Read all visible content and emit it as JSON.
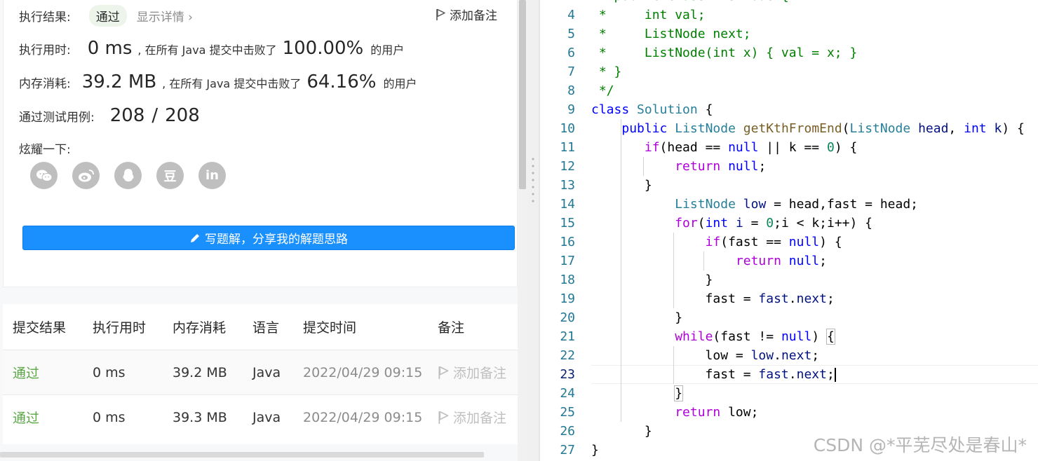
{
  "result": {
    "status_label": "执行结果:",
    "status": "通过",
    "detail_link": "显示详情 ›",
    "add_note": "添加备注",
    "runtime_label": "执行用时:",
    "runtime_value": "0 ms",
    "runtime_text": ", 在所有 Java 提交中击败了",
    "runtime_percent": "100.00%",
    "users_suffix": "的用户",
    "memory_label": "内存消耗:",
    "memory_value": "39.2 MB",
    "memory_text": ", 在所有 Java 提交中击败了",
    "memory_percent": "64.16%",
    "tests_label": "通过测试用例:",
    "tests_passed": "208",
    "tests_sep": "/",
    "tests_total": "208",
    "share_label": "炫耀一下:",
    "share_icons": [
      "wechat-icon",
      "weibo-icon",
      "qq-icon",
      "douban-icon",
      "linkedin-icon"
    ],
    "share_glyphs": [
      "",
      "",
      "",
      "豆",
      "in"
    ],
    "write_solution": "写题解，分享我的解题思路"
  },
  "table": {
    "headers": [
      "提交结果",
      "执行用时",
      "内存消耗",
      "语言",
      "提交时间",
      "备注"
    ],
    "rows": [
      {
        "result": "通过",
        "runtime": "0 ms",
        "memory": "39.2 MB",
        "lang": "Java",
        "time": "2022/04/29 09:15",
        "note": "添加备注"
      },
      {
        "result": "通过",
        "runtime": "0 ms",
        "memory": "39.3 MB",
        "lang": "Java",
        "time": "2022/04/29 09:15",
        "note": "添加备注"
      }
    ]
  },
  "editor": {
    "line_numbers": [
      "4",
      "5",
      "6",
      "7",
      "8",
      "9",
      "10",
      "11",
      "12",
      "13",
      "14",
      "15",
      "16",
      "17",
      "18",
      "19",
      "20",
      "21",
      "22",
      "23",
      "24",
      "25",
      "26",
      "27"
    ],
    "active_line": "23"
  },
  "watermark": "CSDN @*平芜尽处是春山*",
  "colors": {
    "accent": "#1a90ff",
    "pass": "#5ba745",
    "line_number": "#237893"
  }
}
